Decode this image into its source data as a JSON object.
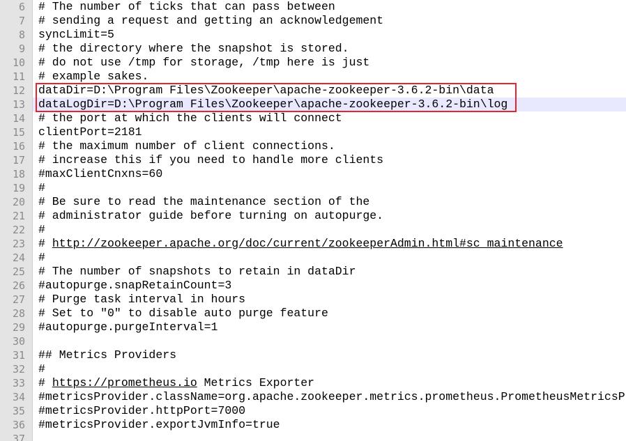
{
  "editor": {
    "current_line": 13,
    "highlight_color": "#e0262f",
    "lines": [
      {
        "num": "6",
        "segments": [
          {
            "text": "# The number of ticks that can pass between"
          }
        ]
      },
      {
        "num": "7",
        "segments": [
          {
            "text": "# sending a request and getting an acknowledgement"
          }
        ]
      },
      {
        "num": "8",
        "segments": [
          {
            "text": "syncLimit=5"
          }
        ]
      },
      {
        "num": "9",
        "segments": [
          {
            "text": "# the directory where the snapshot is stored."
          }
        ]
      },
      {
        "num": "10",
        "segments": [
          {
            "text": "# do not use /tmp for storage, /tmp here is just"
          }
        ]
      },
      {
        "num": "11",
        "segments": [
          {
            "text": "# example sakes."
          }
        ]
      },
      {
        "num": "12",
        "segments": [
          {
            "text": "dataDir=D:\\Program Files\\Zookeeper\\apache-zookeeper-3.6.2-bin\\data"
          }
        ]
      },
      {
        "num": "13",
        "segments": [
          {
            "text": "dataLogDir=D:\\Program Files\\Zookeeper\\apache-zookeeper-3.6.2-bin\\log"
          }
        ]
      },
      {
        "num": "14",
        "segments": [
          {
            "text": "# the port at which the clients will connect"
          }
        ]
      },
      {
        "num": "15",
        "segments": [
          {
            "text": "clientPort=2181"
          }
        ]
      },
      {
        "num": "16",
        "segments": [
          {
            "text": "# the maximum number of client connections."
          }
        ]
      },
      {
        "num": "17",
        "segments": [
          {
            "text": "# increase this if you need to handle more clients"
          }
        ]
      },
      {
        "num": "18",
        "segments": [
          {
            "text": "#maxClientCnxns=60"
          }
        ]
      },
      {
        "num": "19",
        "segments": [
          {
            "text": "#"
          }
        ]
      },
      {
        "num": "20",
        "segments": [
          {
            "text": "# Be sure to read the maintenance section of the"
          }
        ]
      },
      {
        "num": "21",
        "segments": [
          {
            "text": "# administrator guide before turning on autopurge."
          }
        ]
      },
      {
        "num": "22",
        "segments": [
          {
            "text": "#"
          }
        ]
      },
      {
        "num": "23",
        "segments": [
          {
            "text": "# "
          },
          {
            "text": "http://zookeeper.apache.org/doc/current/zookeeperAdmin.html#sc_maintenance",
            "link": true
          }
        ]
      },
      {
        "num": "24",
        "segments": [
          {
            "text": "#"
          }
        ]
      },
      {
        "num": "25",
        "segments": [
          {
            "text": "# The number of snapshots to retain in dataDir"
          }
        ]
      },
      {
        "num": "26",
        "segments": [
          {
            "text": "#autopurge.snapRetainCount=3"
          }
        ]
      },
      {
        "num": "27",
        "segments": [
          {
            "text": "# Purge task interval in hours"
          }
        ]
      },
      {
        "num": "28",
        "segments": [
          {
            "text": "# Set to \"0\" to disable auto purge feature"
          }
        ]
      },
      {
        "num": "29",
        "segments": [
          {
            "text": "#autopurge.purgeInterval=1"
          }
        ]
      },
      {
        "num": "30",
        "segments": [
          {
            "text": ""
          }
        ]
      },
      {
        "num": "31",
        "segments": [
          {
            "text": "## Metrics Providers"
          }
        ]
      },
      {
        "num": "32",
        "segments": [
          {
            "text": "#"
          }
        ]
      },
      {
        "num": "33",
        "segments": [
          {
            "text": "# "
          },
          {
            "text": "https://prometheus.io",
            "link": true
          },
          {
            "text": " Metrics Exporter"
          }
        ]
      },
      {
        "num": "34",
        "segments": [
          {
            "text": "#metricsProvider.className=org.apache.zookeeper.metrics.prometheus.PrometheusMetricsProvider"
          }
        ]
      },
      {
        "num": "35",
        "segments": [
          {
            "text": "#metricsProvider.httpPort=7000"
          }
        ]
      },
      {
        "num": "36",
        "segments": [
          {
            "text": "#metricsProvider.exportJvmInfo=true"
          }
        ]
      },
      {
        "num": "37",
        "segments": [
          {
            "text": ""
          }
        ]
      }
    ]
  }
}
